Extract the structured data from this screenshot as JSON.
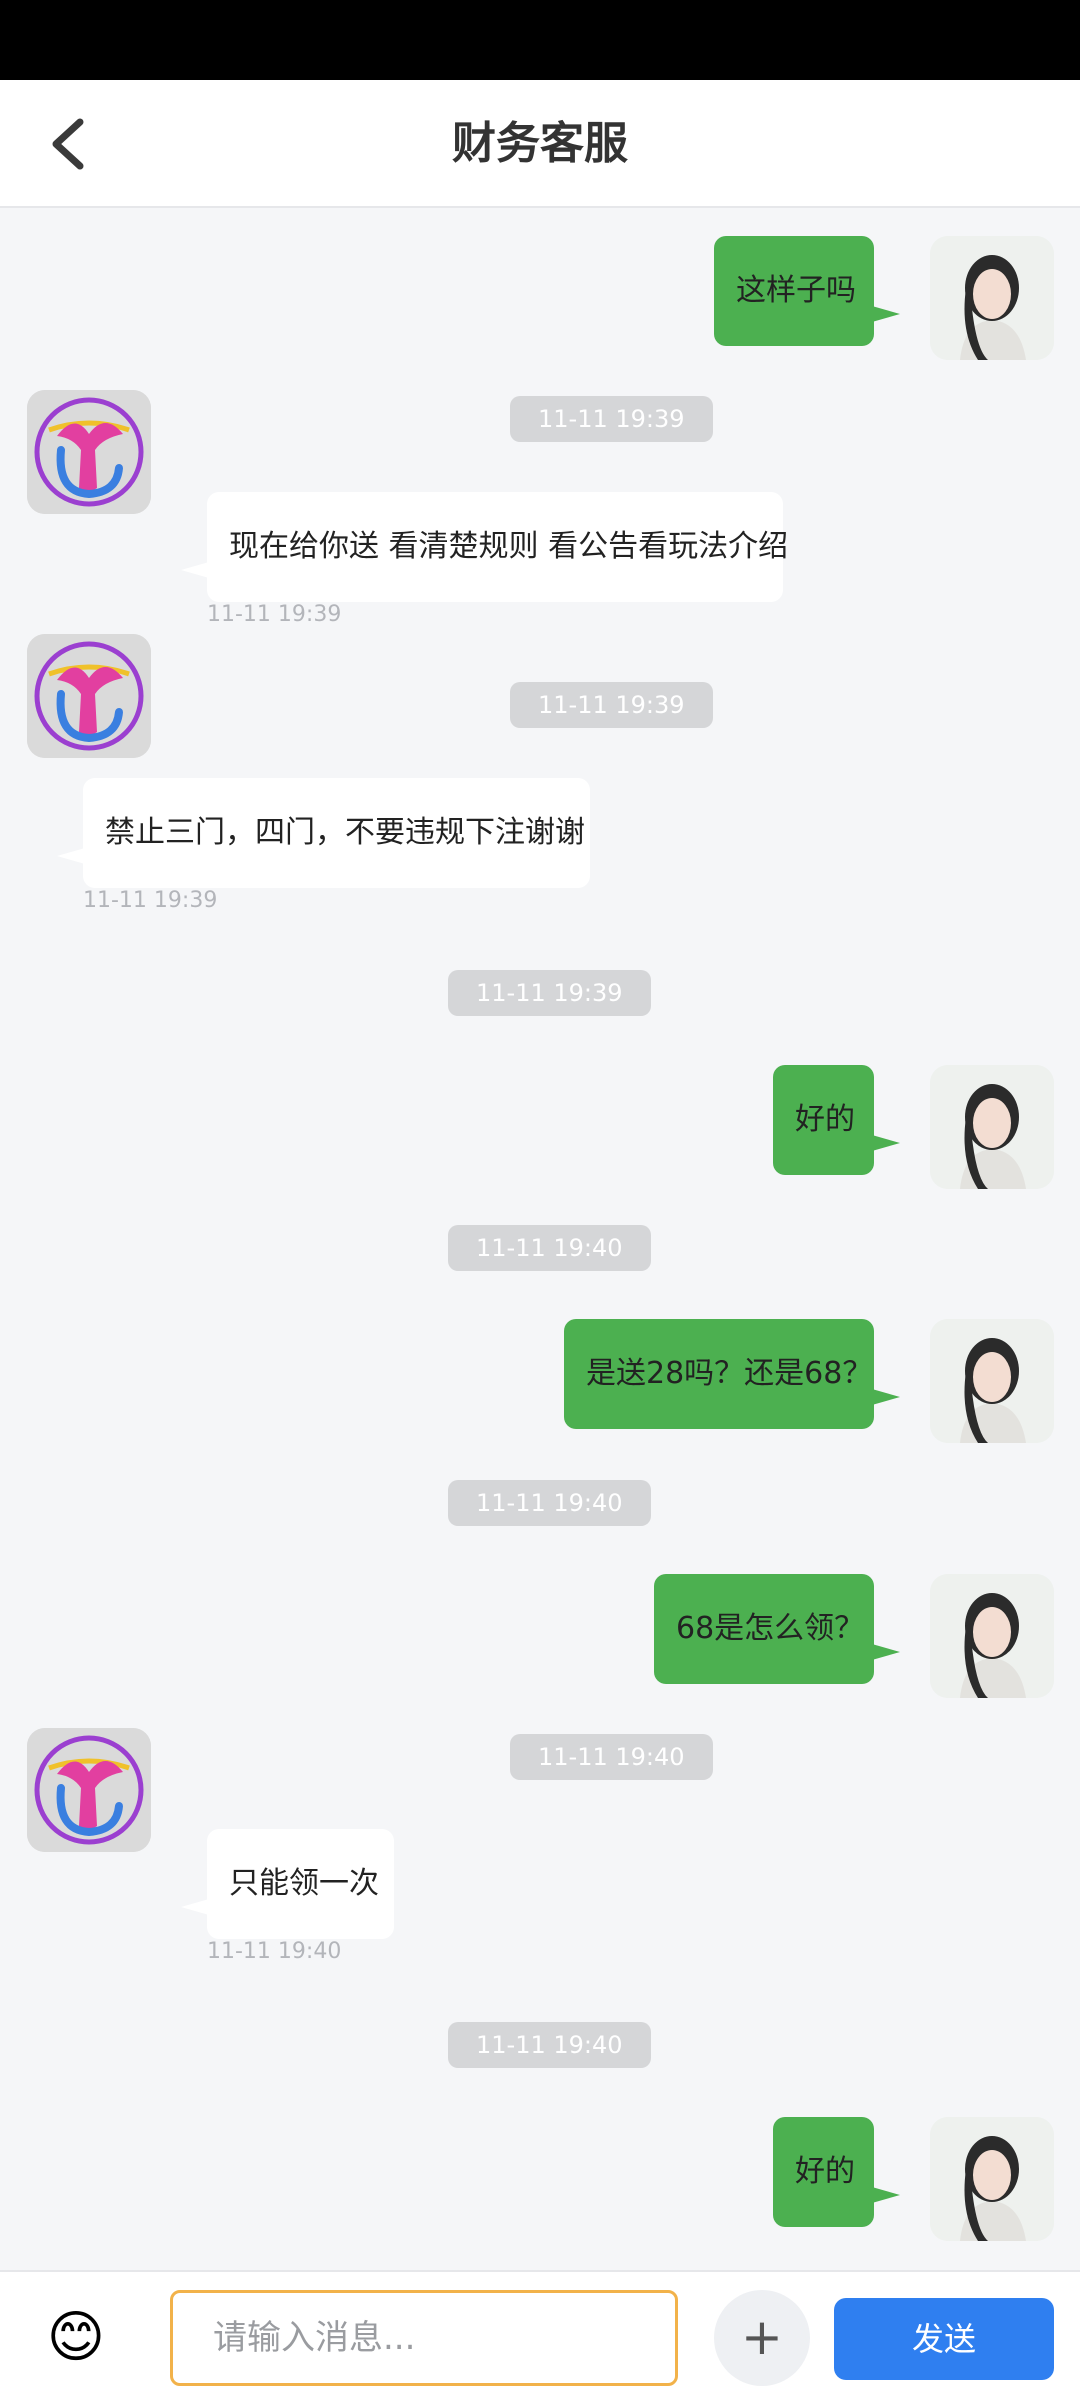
{
  "header": {
    "title": "财务客服"
  },
  "messages": [
    {
      "side": "me",
      "text": "这样子吗"
    },
    {
      "side": "service",
      "time": "11-11 19:39",
      "text": "现在给你送 看清楚规则 看公告看玩法介绍",
      "sub_time": "11-11 19:39"
    },
    {
      "side": "service",
      "time": "11-11 19:39",
      "text": "禁止三门，四门，不要违规下注谢谢",
      "sub_time": "11-11 19:39"
    },
    {
      "side": "me",
      "time": "11-11 19:39",
      "text": "好的"
    },
    {
      "side": "me",
      "time": "11-11 19:40",
      "text": "是送28吗？还是68？"
    },
    {
      "side": "me",
      "time": "11-11 19:40",
      "text": "68是怎么领？"
    },
    {
      "side": "service",
      "time": "11-11 19:40",
      "text": "只能领一次",
      "sub_time": "11-11 19:40"
    },
    {
      "side": "me",
      "time": "11-11 19:40",
      "text": "好的"
    }
  ],
  "input": {
    "placeholder": "请输入消息...",
    "value": ""
  },
  "actions": {
    "send_label": "发送",
    "emoji_glyph": "😊",
    "plus_glyph": "+"
  },
  "icons": {
    "back": "chevron-left-icon",
    "user_avatar": "user-avatar",
    "service_avatar": "service-logo"
  },
  "colors": {
    "my_bubble": "#4cb050",
    "send_button": "#2f7ff0",
    "input_border": "#f2b24a"
  }
}
